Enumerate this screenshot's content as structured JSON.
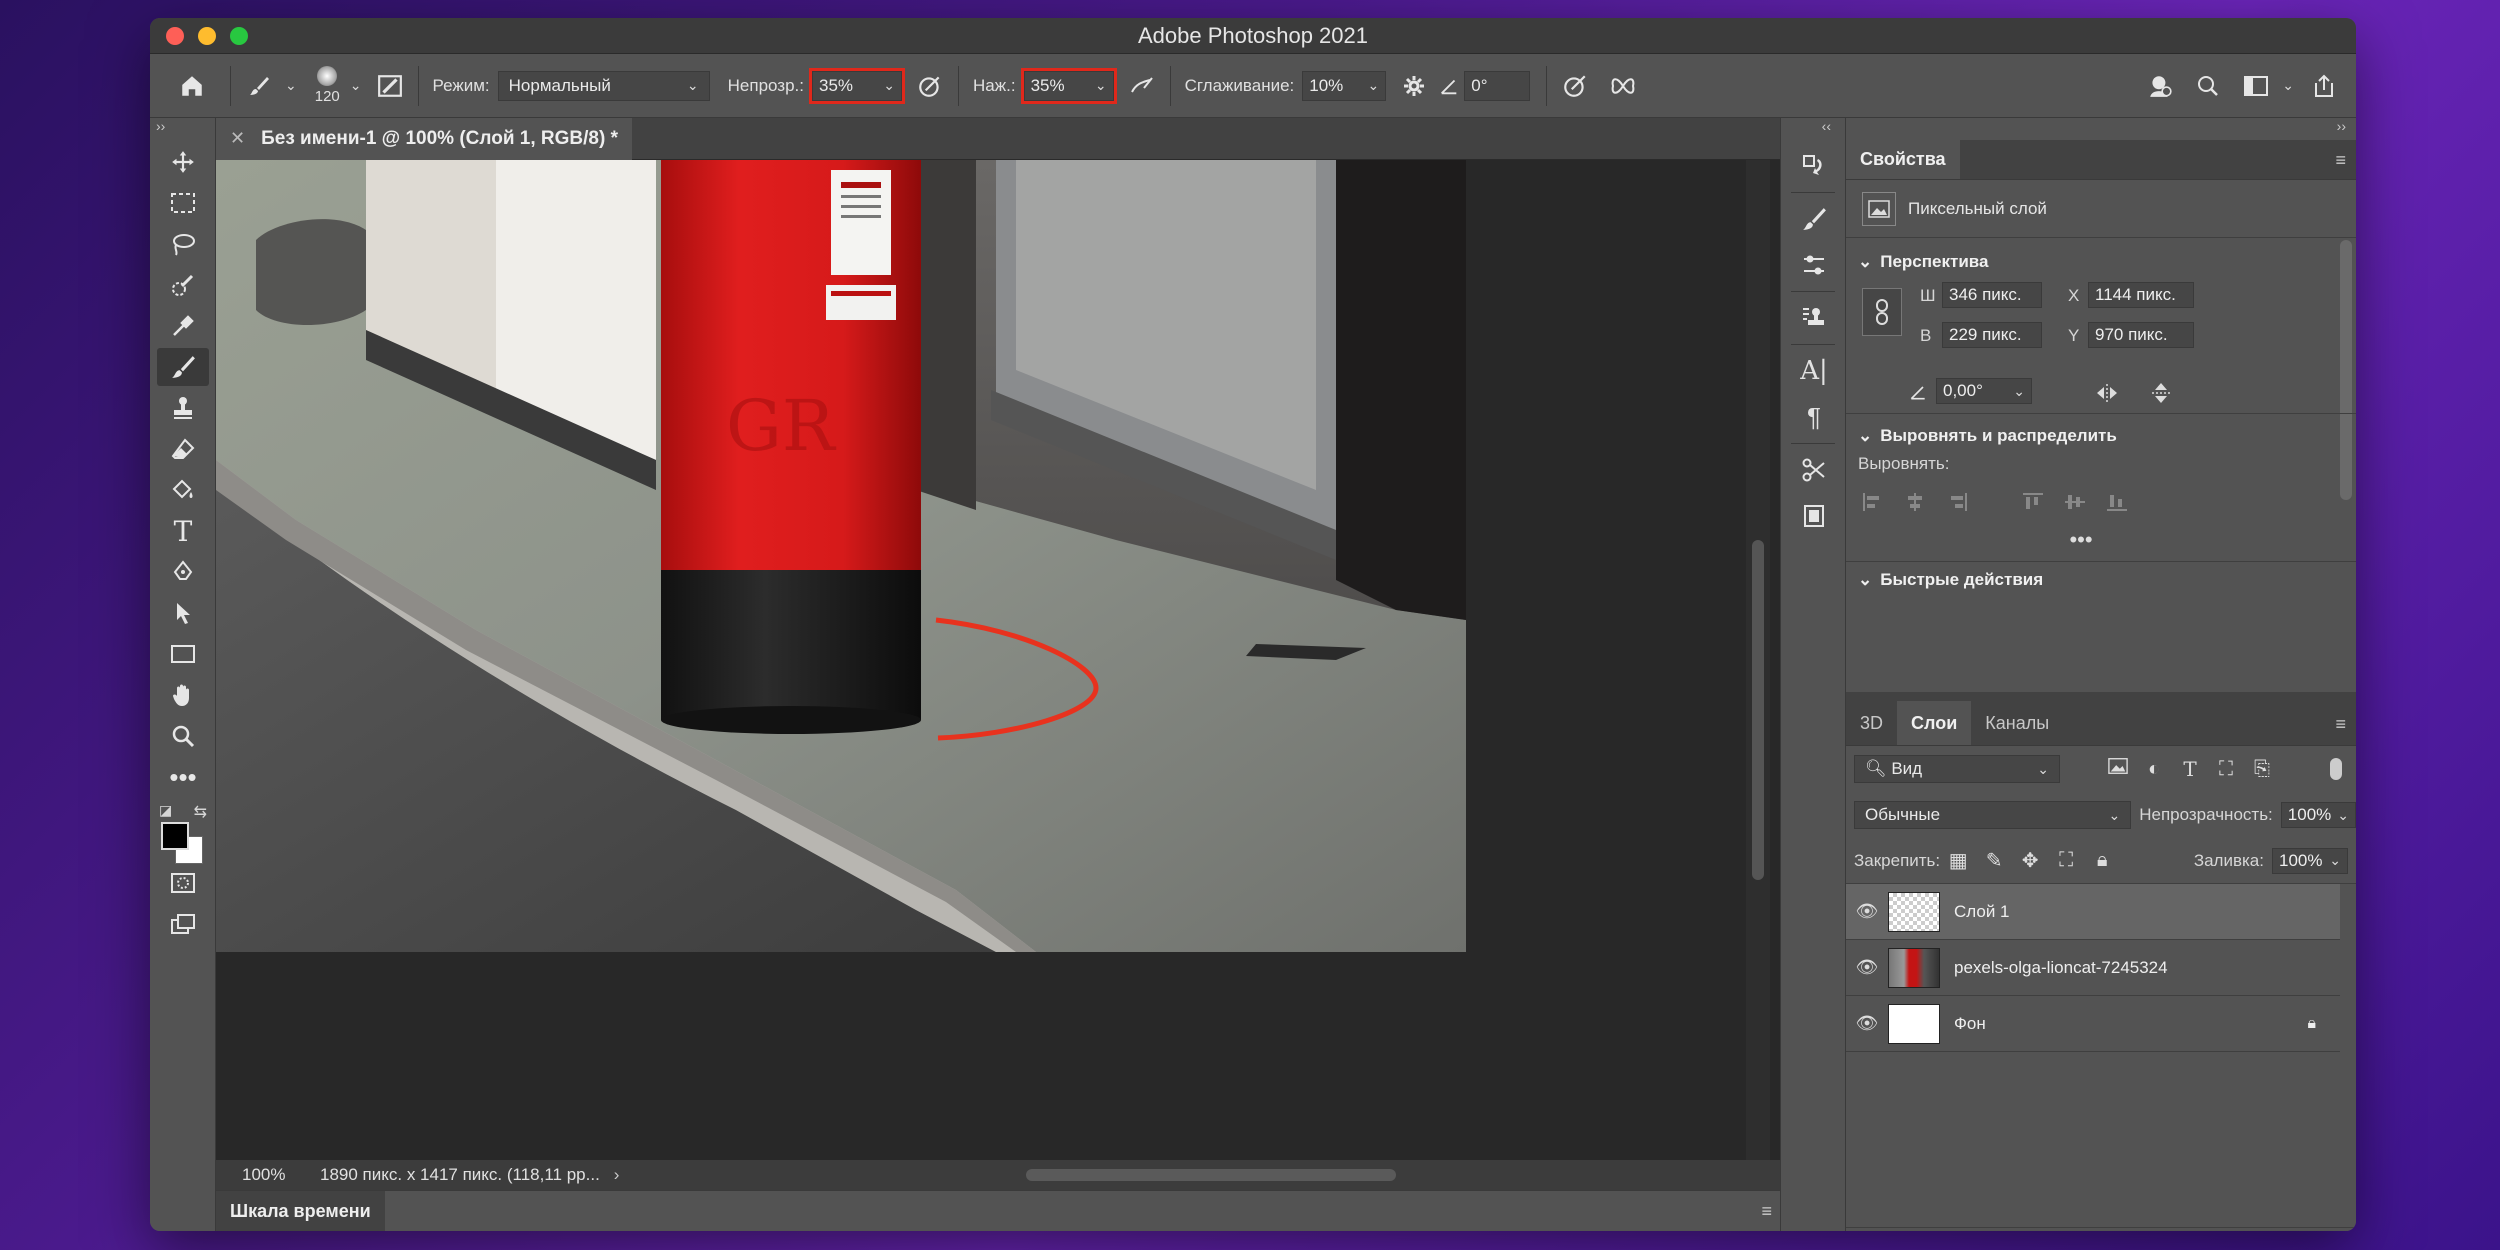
{
  "window": {
    "title": "Adobe Photoshop 2021"
  },
  "options_bar": {
    "brush_size": "120",
    "mode_label": "Режим:",
    "mode_value": "Нормальный",
    "opacity_label": "Непрозр.:",
    "opacity_value": "35%",
    "pressure_label": "Наж.:",
    "pressure_value": "35%",
    "smoothing_label": "Сглаживание:",
    "smoothing_value": "10%",
    "angle_value": "0°"
  },
  "document": {
    "tab_title": "Без имени-1 @ 100% (Слой 1, RGB/8) *",
    "zoom": "100%",
    "doc_info": "1890 пикс. x 1417 пикс. (118,11 рр...",
    "timeline_label": "Шкала времени"
  },
  "properties": {
    "tab_label": "Свойства",
    "layer_type": "Пиксельный слой",
    "perspective_header": "Перспектива",
    "w_label": "Ш",
    "w_value": "346 пикс.",
    "h_label": "В",
    "h_value": "229 пикс.",
    "x_label": "X",
    "x_value": "1144 пикс.",
    "y_label": "Y",
    "y_value": "970 пикс.",
    "angle_value": "0,00°",
    "align_header": "Выровнять и распределить",
    "align_label": "Выровнять:",
    "quick_actions_header": "Быстрые действия"
  },
  "layers_panel": {
    "tabs": [
      "3D",
      "Слои",
      "Каналы"
    ],
    "filter_label": "Вид",
    "blend_mode": "Обычные",
    "opacity_label": "Непрозрачность:",
    "opacity_value": "100%",
    "lock_label": "Закрепить:",
    "fill_label": "Заливка:",
    "fill_value": "100%",
    "layers": [
      {
        "name": "Слой 1"
      },
      {
        "name": "pexels-olga-lioncat-7245324"
      },
      {
        "name": "Фон"
      }
    ]
  },
  "colors": {
    "accent_highlight": "#e0281b",
    "postbox_red": "#d61a1a",
    "stroke_red": "#e8321e"
  }
}
